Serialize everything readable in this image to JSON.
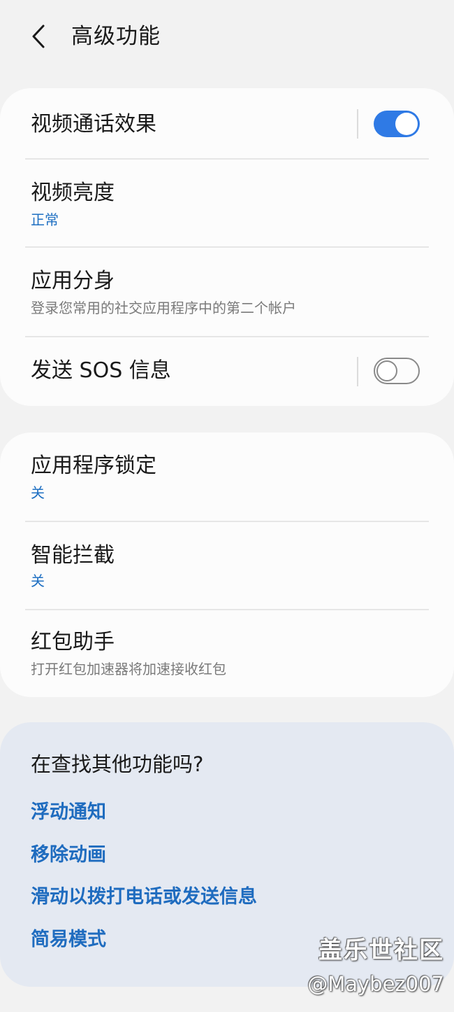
{
  "header": {
    "back_icon": "chevron-left-icon",
    "title": "高级功能"
  },
  "card1": {
    "video_call_effects": {
      "title": "视频通话效果",
      "toggle": "on"
    },
    "video_brightness": {
      "title": "视频亮度",
      "value": "正常"
    },
    "dual_messenger": {
      "title": "应用分身",
      "description": "登录您常用的社交应用程序中的第二个帐户"
    },
    "send_sos": {
      "title": "发送 SOS 信息",
      "toggle": "off"
    }
  },
  "card2": {
    "app_lock": {
      "title": "应用程序锁定",
      "value": "关"
    },
    "smart_block": {
      "title": "智能拦截",
      "value": "关"
    },
    "red_envelope": {
      "title": "红包助手",
      "description": "打开红包加速器将加速接收红包"
    }
  },
  "suggestions": {
    "title": "在查找其他功能吗?",
    "links": [
      "浮动通知",
      "移除动画",
      "滑动以拨打电话或发送信息",
      "简易模式"
    ]
  },
  "watermark": {
    "line1": "盖乐世社区",
    "line2": "@Maybez007"
  },
  "colors": {
    "accent_blue": "#2f7ae5",
    "link_blue": "#1f6cbf",
    "background": "#f2f2f2",
    "card": "#fcfcfc",
    "suggest_card": "#e4e9f2"
  }
}
